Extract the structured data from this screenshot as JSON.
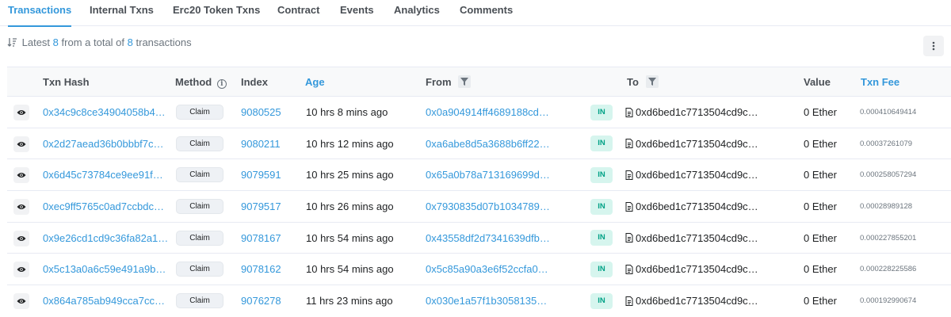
{
  "tabs": [
    {
      "label": "Transactions",
      "active": true
    },
    {
      "label": "Internal Txns",
      "active": false
    },
    {
      "label": "Erc20 Token Txns",
      "active": false
    },
    {
      "label": "Contract",
      "active": false
    },
    {
      "label": "Events",
      "active": false
    },
    {
      "label": "Analytics",
      "active": false
    },
    {
      "label": "Comments",
      "active": false
    }
  ],
  "summary": {
    "prefix": "Latest",
    "latest_count": "8",
    "middle": "from a total of",
    "total_count": "8",
    "suffix": "transactions"
  },
  "menu_icon": "vertical-ellipsis-icon",
  "columns": {
    "txn_hash": "Txn Hash",
    "method": "Method",
    "index": "Index",
    "age": "Age",
    "from": "From",
    "to": "To",
    "value": "Value",
    "txn_fee": "Txn Fee"
  },
  "colors": {
    "accent": "#3498db",
    "in_badge_text": "#00a186",
    "in_badge_bg": "#d6f5ee"
  },
  "rows": [
    {
      "hash": "0x34c9c8ce34904058b4…",
      "method": "Claim",
      "index": "9080525",
      "age": "10 hrs 8 mins ago",
      "from": "0x0a904914ff4689188cd…",
      "direction": "IN",
      "to": "0xd6bed1c7713504cd9c…",
      "value": "0 Ether",
      "fee": "0.000410649414"
    },
    {
      "hash": "0x2d27aead36b0bbbf7c…",
      "method": "Claim",
      "index": "9080211",
      "age": "10 hrs 12 mins ago",
      "from": "0xa6abe8d5a3688b6ff22…",
      "direction": "IN",
      "to": "0xd6bed1c7713504cd9c…",
      "value": "0 Ether",
      "fee": "0.00037261079"
    },
    {
      "hash": "0x6d45c73784ce9ee91f…",
      "method": "Claim",
      "index": "9079591",
      "age": "10 hrs 25 mins ago",
      "from": "0x65a0b78a713169699d…",
      "direction": "IN",
      "to": "0xd6bed1c7713504cd9c…",
      "value": "0 Ether",
      "fee": "0.000258057294"
    },
    {
      "hash": "0xec9ff5765c0ad7ccbdc…",
      "method": "Claim",
      "index": "9079517",
      "age": "10 hrs 26 mins ago",
      "from": "0x7930835d07b1034789…",
      "direction": "IN",
      "to": "0xd6bed1c7713504cd9c…",
      "value": "0 Ether",
      "fee": "0.00028989128"
    },
    {
      "hash": "0x9e26cd1cd9c36fa82a1…",
      "method": "Claim",
      "index": "9078167",
      "age": "10 hrs 54 mins ago",
      "from": "0x43558df2d7341639dfb…",
      "direction": "IN",
      "to": "0xd6bed1c7713504cd9c…",
      "value": "0 Ether",
      "fee": "0.000227855201"
    },
    {
      "hash": "0x5c13a0a6c59e491a9b…",
      "method": "Claim",
      "index": "9078162",
      "age": "10 hrs 54 mins ago",
      "from": "0x5c85a90a3e6f52ccfa0…",
      "direction": "IN",
      "to": "0xd6bed1c7713504cd9c…",
      "value": "0 Ether",
      "fee": "0.000228225586"
    },
    {
      "hash": "0x864a785ab949cca7cc…",
      "method": "Claim",
      "index": "9076278",
      "age": "11 hrs 23 mins ago",
      "from": "0x030e1a57f1b3058135…",
      "direction": "IN",
      "to": "0xd6bed1c7713504cd9c…",
      "value": "0 Ether",
      "fee": "0.000192990674"
    }
  ]
}
